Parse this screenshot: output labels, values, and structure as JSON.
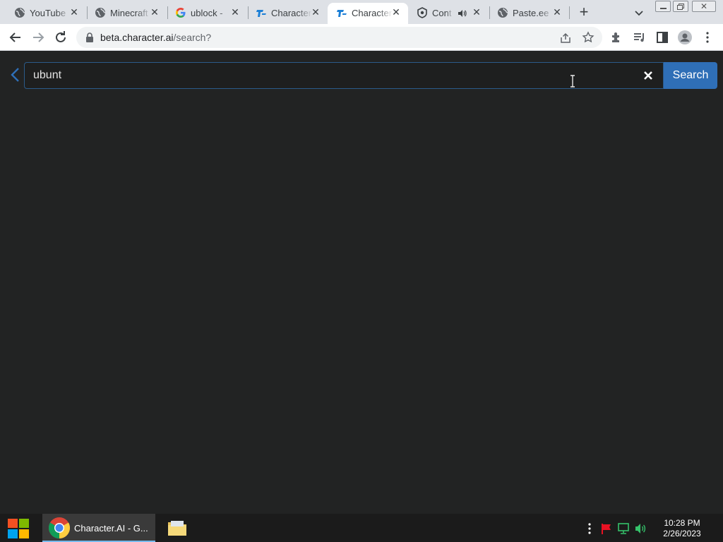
{
  "browser": {
    "tabs": [
      {
        "title": "YouTube",
        "icon": "globe-icon"
      },
      {
        "title": "Minecraft",
        "icon": "globe-icon"
      },
      {
        "title": "ublock -",
        "icon": "google-icon"
      },
      {
        "title": "Character",
        "icon": "character-ai-icon"
      },
      {
        "title": "Character",
        "icon": "character-ai-icon",
        "active": true
      },
      {
        "title": "Cont",
        "icon": "pinned-app-icon",
        "audio": "speaker-icon"
      },
      {
        "title": "Paste.ee",
        "icon": "globe-icon"
      }
    ],
    "url_host": "beta.character.ai",
    "url_path": "/search?"
  },
  "search": {
    "value": "ubunt",
    "button_label": "Search"
  },
  "colors": {
    "page_bg": "#222323",
    "accent": "#2f6fb7",
    "tab_strip": "#dee1e6"
  },
  "taskbar": {
    "app_label": "Character.AI - G...",
    "time": "10:28 PM",
    "date": "2/26/2023"
  }
}
